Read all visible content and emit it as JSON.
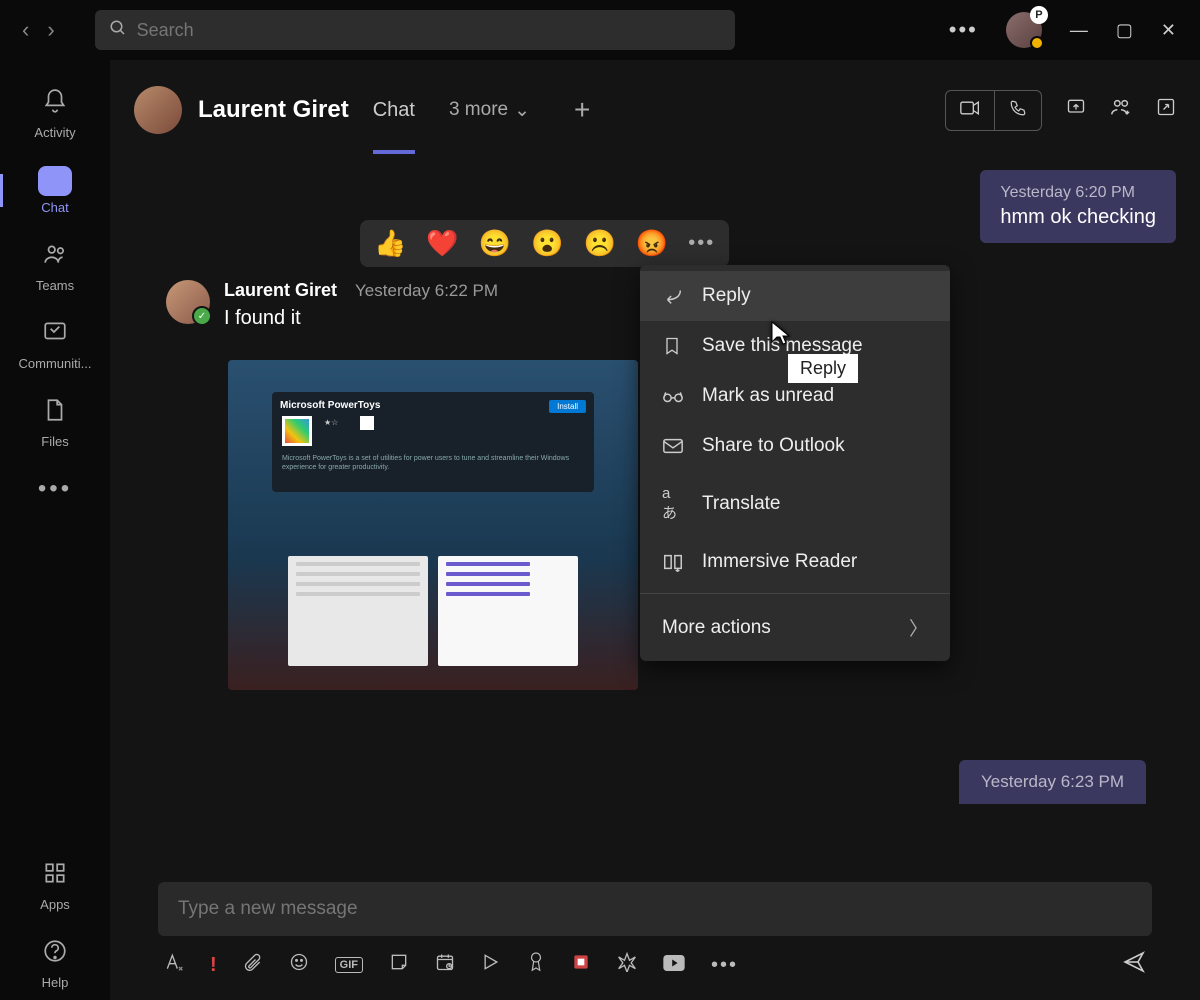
{
  "titlebar": {
    "search_placeholder": "Search",
    "avatar_badge": "P"
  },
  "rail": {
    "items": [
      {
        "label": "Activity"
      },
      {
        "label": "Chat"
      },
      {
        "label": "Teams"
      },
      {
        "label": "Communiti..."
      },
      {
        "label": "Files"
      }
    ],
    "apps_label": "Apps",
    "help_label": "Help"
  },
  "chat_header": {
    "title": "Laurent Giret",
    "tab": "Chat",
    "more": "3 more"
  },
  "messages": {
    "self1_time": "Yesterday 6:20 PM",
    "self1_text": "hmm ok checking",
    "other_author": "Laurent Giret",
    "other_time": "Yesterday 6:22 PM",
    "other_text": "I found it",
    "attachment_title": "Microsoft PowerToys",
    "attachment_install": "Install",
    "self2_time": "Yesterday 6:23 PM"
  },
  "reactions": [
    "👍",
    "❤️",
    "😄",
    "😮",
    "☹️",
    "😡"
  ],
  "context_menu": {
    "items": [
      "Reply",
      "Save this message",
      "Mark as unread",
      "Share to Outlook",
      "Translate",
      "Immersive Reader"
    ],
    "more": "More actions"
  },
  "tooltip": "Reply",
  "composer": {
    "placeholder": "Type a new message"
  }
}
